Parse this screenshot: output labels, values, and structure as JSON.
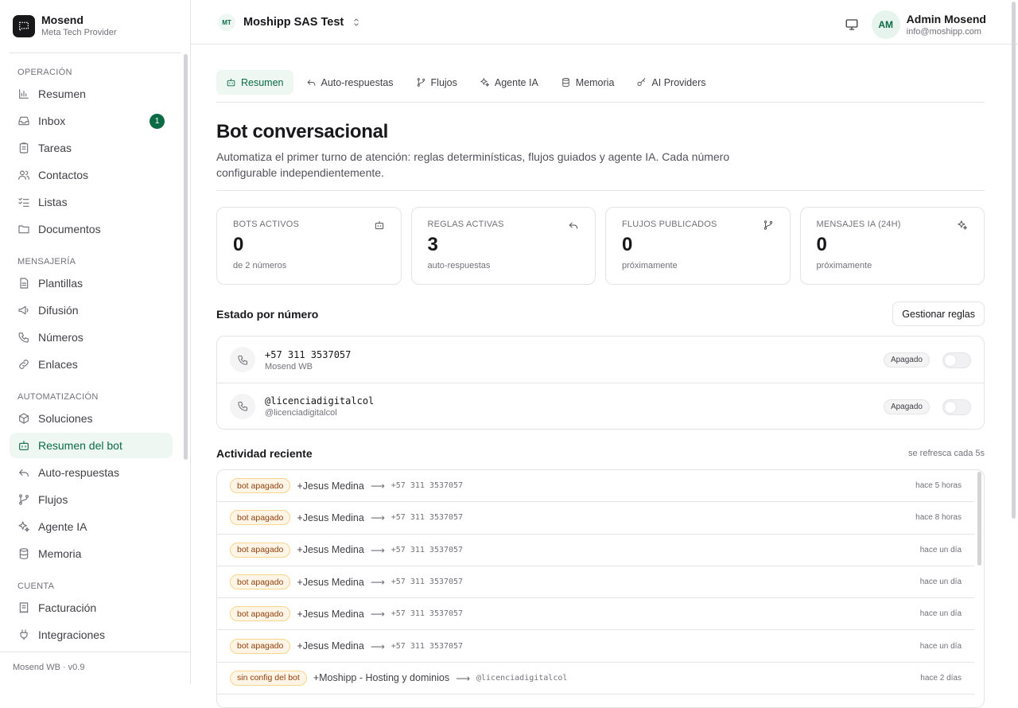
{
  "brand": {
    "name": "Mosend",
    "subtitle": "Meta Tech Provider"
  },
  "sidebar": {
    "sections": [
      {
        "label": "OPERACIÓN",
        "items": [
          {
            "label": "Resumen",
            "icon": "bar-chart-icon"
          },
          {
            "label": "Inbox",
            "icon": "inbox-icon",
            "badge": "1"
          },
          {
            "label": "Tareas",
            "icon": "clipboard-icon"
          },
          {
            "label": "Contactos",
            "icon": "users-icon"
          },
          {
            "label": "Listas",
            "icon": "list-checks-icon"
          },
          {
            "label": "Documentos",
            "icon": "folder-icon"
          }
        ]
      },
      {
        "label": "MENSAJERÍA",
        "items": [
          {
            "label": "Plantillas",
            "icon": "file-text-icon"
          },
          {
            "label": "Difusión",
            "icon": "megaphone-icon"
          },
          {
            "label": "Números",
            "icon": "phone-icon"
          },
          {
            "label": "Enlaces",
            "icon": "link-icon"
          }
        ]
      },
      {
        "label": "AUTOMATIZACIÓN",
        "items": [
          {
            "label": "Soluciones",
            "icon": "package-icon"
          },
          {
            "label": "Resumen del bot",
            "icon": "bot-icon",
            "active": true
          },
          {
            "label": "Auto-respuestas",
            "icon": "reply-icon"
          },
          {
            "label": "Flujos",
            "icon": "git-branch-icon"
          },
          {
            "label": "Agente IA",
            "icon": "sparkles-icon"
          },
          {
            "label": "Memoria",
            "icon": "database-icon"
          }
        ]
      },
      {
        "label": "CUENTA",
        "items": [
          {
            "label": "Facturación",
            "icon": "receipt-icon"
          },
          {
            "label": "Integraciones",
            "icon": "plug-icon"
          }
        ]
      }
    ],
    "footer": "Mosend WB · v0.9"
  },
  "topbar": {
    "workspace_initials": "MT",
    "workspace_name": "Moshipp SAS Test",
    "user_initials": "AM",
    "user_name": "Admin Mosend",
    "user_email": "info@moshipp.com"
  },
  "tabs": [
    {
      "label": "Resumen",
      "icon": "bot-icon",
      "active": true
    },
    {
      "label": "Auto-respuestas",
      "icon": "reply-icon"
    },
    {
      "label": "Flujos",
      "icon": "git-branch-icon"
    },
    {
      "label": "Agente IA",
      "icon": "sparkles-icon"
    },
    {
      "label": "Memoria",
      "icon": "database-icon"
    },
    {
      "label": "AI Providers",
      "icon": "key-icon"
    }
  ],
  "page": {
    "title": "Bot conversacional",
    "description": "Automatiza el primer turno de atención: reglas determinísticas, flujos guiados y agente IA. Cada número configurable independientemente."
  },
  "stats": [
    {
      "label": "BOTS ACTIVOS",
      "value": "0",
      "sub": "de 2 números",
      "icon": "bot-icon"
    },
    {
      "label": "REGLAS ACTIVAS",
      "value": "3",
      "sub": "auto-respuestas",
      "icon": "reply-icon"
    },
    {
      "label": "FLUJOS PUBLICADOS",
      "value": "0",
      "sub": "próximamente",
      "icon": "git-branch-icon"
    },
    {
      "label": "MENSAJES IA (24H)",
      "value": "0",
      "sub": "próximamente",
      "icon": "sparkles-icon"
    }
  ],
  "numbers_section": {
    "title": "Estado por número",
    "manage_label": "Gestionar reglas",
    "rows": [
      {
        "number": "+57 311 3537057",
        "name": "Mosend WB",
        "status": "Apagado"
      },
      {
        "number": "@licenciadigitalcol",
        "name": "@licenciadigitalcol",
        "status": "Apagado"
      }
    ]
  },
  "activity": {
    "title": "Actividad reciente",
    "refresh": "se refresca cada 5s",
    "rows": [
      {
        "tag": "bot apagado",
        "contact": "+Jesus Medina",
        "number": "+57 311 3537057",
        "time": "hace 5 horas"
      },
      {
        "tag": "bot apagado",
        "contact": "+Jesus Medina",
        "number": "+57 311 3537057",
        "time": "hace 8 horas"
      },
      {
        "tag": "bot apagado",
        "contact": "+Jesus Medina",
        "number": "+57 311 3537057",
        "time": "hace un día"
      },
      {
        "tag": "bot apagado",
        "contact": "+Jesus Medina",
        "number": "+57 311 3537057",
        "time": "hace un día"
      },
      {
        "tag": "bot apagado",
        "contact": "+Jesus Medina",
        "number": "+57 311 3537057",
        "time": "hace un día"
      },
      {
        "tag": "bot apagado",
        "contact": "+Jesus Medina",
        "number": "+57 311 3537057",
        "time": "hace un día"
      },
      {
        "tag": "sin config del bot",
        "contact": "+Moshipp - Hosting y dominios",
        "number": "@licenciadigitalcol",
        "time": "hace 2 días"
      }
    ]
  },
  "colors": {
    "accent": "#0b6b45",
    "accent_bg": "#eef7f2",
    "warn_bg": "#fef5e6",
    "warn_text": "#92400e"
  }
}
